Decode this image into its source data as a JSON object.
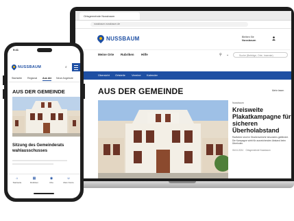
{
  "brand": {
    "name": "NUSSBAUM",
    "primary": "#1e4fa3",
    "accent": "#f0b400"
  },
  "laptop": {
    "tab_title": "Ortsgemeinde Nussbaum",
    "url": "nussbaum.nussbaum.de",
    "weather_label": "Bleiben Sie",
    "weather_value": "Nussbaum",
    "nav": [
      "Meine Orte",
      "Rubriken",
      "Hilfe"
    ],
    "search_placeholder": "Suche (Beiträge, Orte, Inserate)",
    "strip": [
      "Übersicht",
      "Ortsteile",
      "Vereine",
      "Kalender"
    ],
    "section_title": "AUS DER GEMEINDE",
    "read_more": "Mehr lesen",
    "article": {
      "kicker": "Nussbaum",
      "headline": "Kreisweite Plakatkampagne für sicheren Überholabstand",
      "teaser": "Radfahrer sind im Straßenverkehr besonders gefährdet. Die Kampagne wirbt für ausreichenden Abstand beim Überholen.",
      "date": "06.04.2024",
      "author": "Ortsgemeinde Nussbaum"
    }
  },
  "phone": {
    "time": "9:41",
    "tabs": [
      "Startseite",
      "Regional",
      "Aus der",
      "Neue Angebote"
    ],
    "section_title": "AUS DER GEMEINDE",
    "headline": "Sitzung des Gemeinderats wahlausschusses",
    "bottom_tabs": [
      {
        "icon": "home-icon",
        "glyph": "⌂",
        "label": "Startseite"
      },
      {
        "icon": "grid-icon",
        "glyph": "▦",
        "label": "Rubriken"
      },
      {
        "icon": "pin-icon",
        "glyph": "◉",
        "label": "Orte"
      },
      {
        "icon": "user-icon",
        "glyph": "☺",
        "label": "Mein Konto"
      }
    ]
  }
}
